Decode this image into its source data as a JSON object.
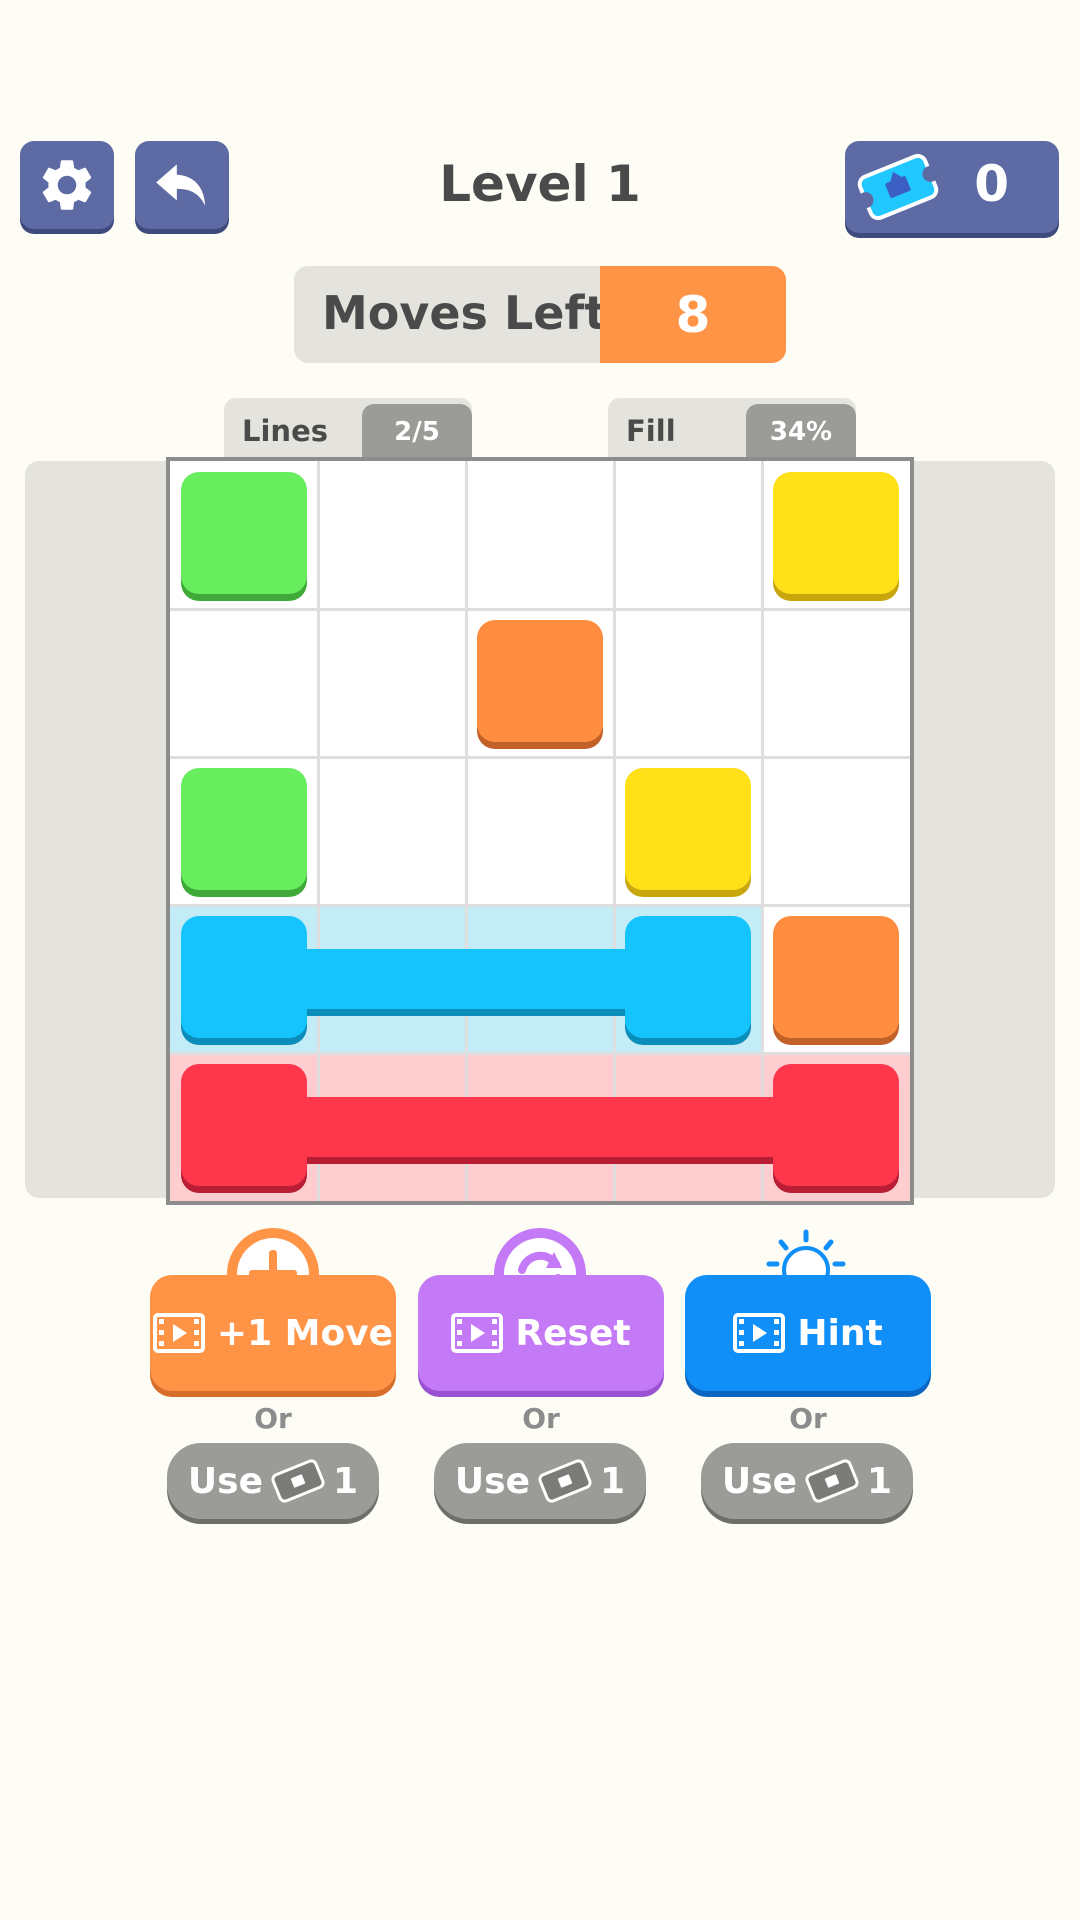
{
  "header": {
    "level_title": "Level 1",
    "ticket_count": "0"
  },
  "moves": {
    "label": "Moves Left",
    "value": "8"
  },
  "stats": {
    "lines_label": "Lines",
    "lines_value": "2/5",
    "fill_label": "Fill",
    "fill_value": "34%"
  },
  "board": {
    "rows": 5,
    "cols": 5,
    "tiles": [
      {
        "row": 0,
        "col": 0,
        "color": "green"
      },
      {
        "row": 0,
        "col": 4,
        "color": "yellow"
      },
      {
        "row": 1,
        "col": 2,
        "color": "orange"
      },
      {
        "row": 2,
        "col": 0,
        "color": "green"
      },
      {
        "row": 2,
        "col": 3,
        "color": "yellow"
      },
      {
        "row": 3,
        "col": 0,
        "color": "blue"
      },
      {
        "row": 3,
        "col": 3,
        "color": "blue"
      },
      {
        "row": 3,
        "col": 4,
        "color": "orange"
      },
      {
        "row": 4,
        "col": 0,
        "color": "red"
      },
      {
        "row": 4,
        "col": 4,
        "color": "red"
      }
    ],
    "connected_lines": [
      {
        "color": "blue",
        "row": 3,
        "from_col": 0,
        "to_col": 3
      },
      {
        "color": "red",
        "row": 4,
        "from_col": 0,
        "to_col": 4
      }
    ],
    "colors": {
      "green": "#68ed5f",
      "yellow": "#ffe019",
      "orange": "#ff8d3f",
      "blue": "#15c4fd",
      "red": "#ff374d"
    }
  },
  "actions": {
    "add_move_label": "+1 Move",
    "reset_label": "Reset",
    "hint_label": "Hint",
    "or_text": "Or",
    "use_label": "Use",
    "use_cost": "1"
  }
}
